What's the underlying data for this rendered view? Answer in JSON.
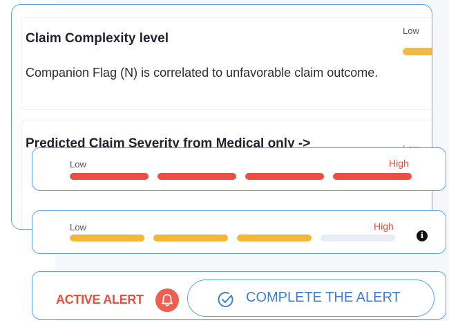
{
  "claim_complexity": {
    "title": "Claim Complexity level",
    "description": "Companion Flag (N) is correlated to unfavorable claim outcome.",
    "level_label": "Low"
  },
  "severity": {
    "title": "Predicted Claim Severity from Medical only ->",
    "level_label": "Low"
  },
  "red_meter": {
    "low_label": "Low",
    "high_label": "High",
    "filled_segments": 4,
    "total_segments": 4,
    "color": "#ec4f3f"
  },
  "yellow_meter": {
    "low_label": "Low",
    "high_label": "High",
    "filled_segments": 3,
    "total_segments": 4,
    "color": "#f4b733",
    "empty_color": "#e8ecf3",
    "info_icon": "info-icon"
  },
  "alert": {
    "active_label": "ACTIVE ALERT",
    "bell_icon": "bell-icon",
    "complete_label": "COMPLETE THE ALERT",
    "check_icon": "check-circle-icon"
  },
  "colors": {
    "accent_border": "#5ba4e8",
    "alert_red": "#e8503f",
    "button_blue": "#3b7fd6"
  }
}
